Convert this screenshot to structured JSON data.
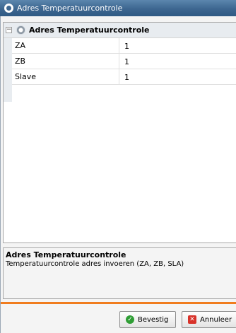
{
  "window": {
    "title": "Adres Temperatuurcontrole"
  },
  "grid": {
    "category": "Adres Temperatuurcontrole",
    "rows": [
      {
        "name": "ZA",
        "value": "1"
      },
      {
        "name": "ZB",
        "value": "1"
      },
      {
        "name": "Slave",
        "value": "1"
      }
    ]
  },
  "description": {
    "title": "Adres Temperatuurcontrole",
    "text": "Temperatuurcontrole adres invoeren (ZA, ZB, SLA)"
  },
  "buttons": {
    "confirm": "Bevestig",
    "cancel": "Annuleer"
  },
  "icons": {
    "app": "app-icon",
    "gear": "gear-icon",
    "confirm": "check-icon",
    "cancel": "close-icon"
  },
  "colors": {
    "accent": "#f07c1e",
    "titlebar": "#3d6690"
  }
}
